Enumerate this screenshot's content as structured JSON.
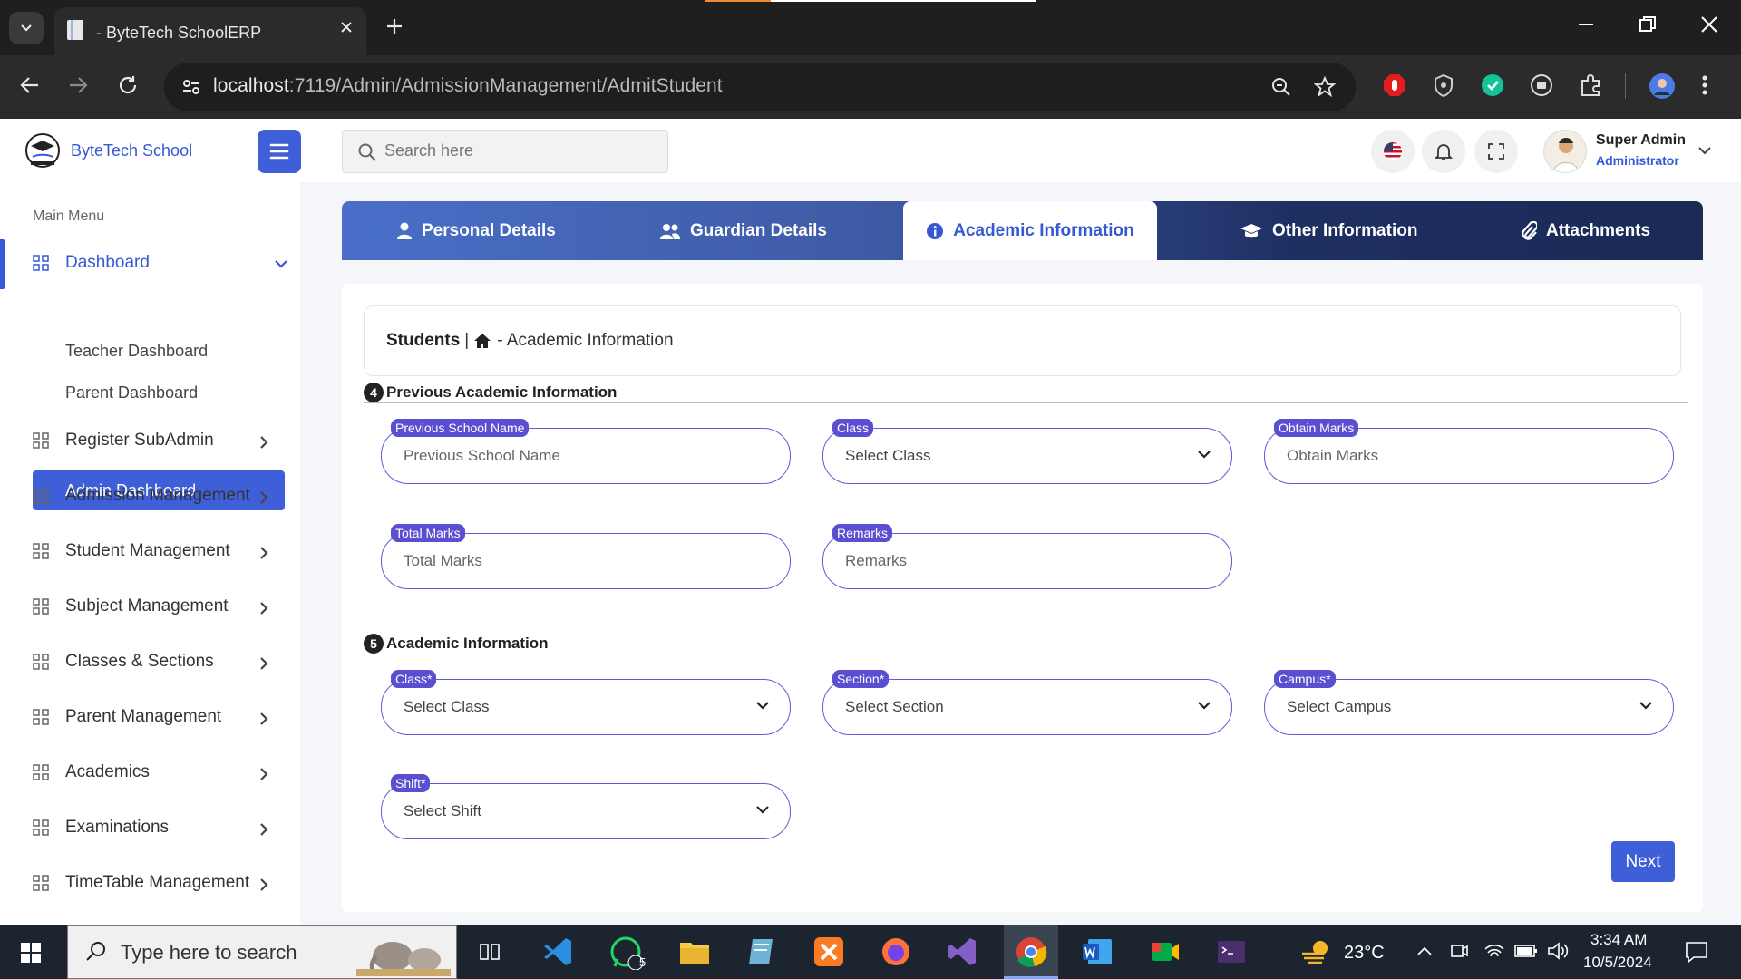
{
  "browser": {
    "tab_title": "- ByteTech SchoolERP",
    "url_host": "localhost",
    "url_path": ":7119/Admin/AdmissionManagement/AdmitStudent"
  },
  "header": {
    "brand": "ByteTech School",
    "search_placeholder": "Search here",
    "user_name": "Super Admin",
    "user_role": "Administrator"
  },
  "sidebar": {
    "caption": "Main Menu",
    "dashboard": "Dashboard",
    "sub_items": [
      "Admin Dashboard",
      "Teacher Dashboard",
      "Parent Dashboard"
    ],
    "items": [
      "Register SubAdmin",
      "Admission Management",
      "Student Management",
      "Subject Management",
      "Classes & Sections",
      "Parent Management",
      "Academics",
      "Examinations",
      "TimeTable Management"
    ]
  },
  "tabs": [
    "Personal Details",
    "Guardian Details",
    "Academic Information",
    "Other Information",
    "Attachments"
  ],
  "breadcrumb": {
    "root": "Students",
    "separator": "|",
    "current": "- Academic Information"
  },
  "previous_section": {
    "number": "4",
    "title": "Previous Academic Information",
    "fields": {
      "school": {
        "label": "Previous School Name",
        "placeholder": "Previous School Name"
      },
      "class": {
        "label": "Class",
        "value": "Select Class"
      },
      "obtain": {
        "label": "Obtain Marks",
        "placeholder": "Obtain Marks"
      },
      "total": {
        "label": "Total Marks",
        "placeholder": "Total Marks"
      },
      "remarks": {
        "label": "Remarks",
        "placeholder": "Remarks"
      }
    }
  },
  "academic_section": {
    "number": "5",
    "title": "Academic Information",
    "fields": {
      "class": {
        "label": "Class*",
        "value": "Select Class"
      },
      "section": {
        "label": "Section*",
        "value": "Select Section"
      },
      "campus": {
        "label": "Campus*",
        "value": "Select Campus"
      },
      "shift": {
        "label": "Shift*",
        "value": "Select Shift"
      }
    }
  },
  "next_label": "Next",
  "taskbar": {
    "search": "Type here to search",
    "whatsapp_badge": "5",
    "weather": "23°C",
    "time": "3:34 AM",
    "date": "10/5/2024"
  },
  "colors": {
    "accent": "#3f5fd8",
    "field_border": "#5b5fd1"
  }
}
